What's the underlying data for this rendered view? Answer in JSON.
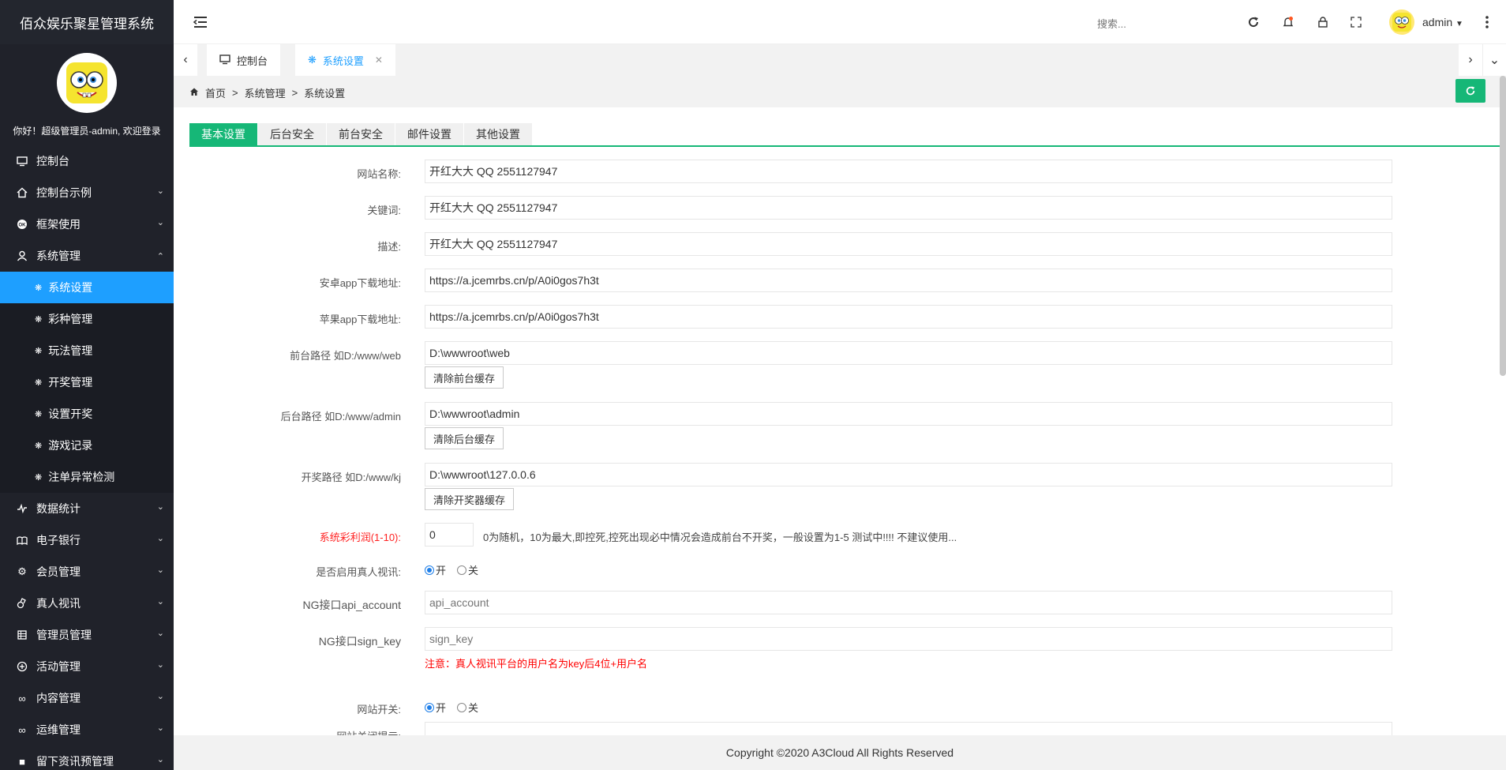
{
  "app": {
    "title": "佰众娱乐聚星管理系统",
    "welcome": "你好！超级管理员-admin, 欢迎登录"
  },
  "sidebar": {
    "items": [
      {
        "label": "控制台",
        "icon": "monitor-icon",
        "has_arrow": false
      },
      {
        "label": "控制台示例",
        "icon": "home-icon",
        "has_arrow": true
      },
      {
        "label": "框架使用",
        "icon": "ok-icon",
        "has_arrow": true
      },
      {
        "label": "系统管理",
        "icon": "user-icon",
        "has_arrow": true,
        "expanded": true
      }
    ],
    "sub_items": [
      {
        "label": "系统设置",
        "active": true
      },
      {
        "label": "彩种管理"
      },
      {
        "label": "玩法管理"
      },
      {
        "label": "开奖管理"
      },
      {
        "label": "设置开奖"
      },
      {
        "label": "游戏记录"
      },
      {
        "label": "注单异常检测"
      }
    ],
    "items_after": [
      {
        "label": "数据统计",
        "icon": "chart-icon"
      },
      {
        "label": "电子银行",
        "icon": "bank-icon"
      },
      {
        "label": "会员管理",
        "icon": "gear-icon"
      },
      {
        "label": "真人视讯",
        "icon": "video-icon"
      },
      {
        "label": "管理员管理",
        "icon": "grid-icon"
      },
      {
        "label": "活动管理",
        "icon": "plus-circle-icon"
      },
      {
        "label": "内容管理",
        "icon": "link-icon"
      },
      {
        "label": "运维管理",
        "icon": "link-icon"
      },
      {
        "label": "留下资讯预管理",
        "icon": "box-icon"
      }
    ]
  },
  "header": {
    "search_placeholder": "搜索...",
    "username": "admin"
  },
  "tabs": [
    {
      "label": "控制台",
      "icon": "monitor-icon",
      "active": false
    },
    {
      "label": "系统设置",
      "icon": "fan-icon",
      "active": true
    }
  ],
  "breadcrumb": {
    "home": "首页",
    "sep": ">",
    "level1": "系统管理",
    "level2": "系统设置"
  },
  "content_tabs": [
    "基本设置",
    "后台安全",
    "前台安全",
    "邮件设置",
    "其他设置"
  ],
  "form": {
    "site_name": {
      "label": "网站名称:",
      "value": "开红大大 QQ 2551127947"
    },
    "keywords": {
      "label": "关键词:",
      "value": "开红大大 QQ 2551127947"
    },
    "description": {
      "label": "描述:",
      "value": "开红大大 QQ 2551127947"
    },
    "android_url": {
      "label": "安卓app下载地址:",
      "value": "https://a.jcemrbs.cn/p/A0i0gos7h3t"
    },
    "ios_url": {
      "label": "苹果app下载地址:",
      "value": "https://a.jcemrbs.cn/p/A0i0gos7h3t"
    },
    "front_path": {
      "label": "前台路径 如D:/www/web",
      "value": "D:\\wwwroot\\web",
      "button": "清除前台缓存"
    },
    "admin_path": {
      "label": "后台路径 如D:/www/admin",
      "value": "D:\\wwwroot\\admin",
      "button": "清除后台缓存"
    },
    "lottery_path": {
      "label": "开奖路径 如D:/www/kj",
      "value": "D:\\wwwroot\\127.0.0.6",
      "button": "清除开奖器缓存"
    },
    "profit": {
      "label": "系统彩利润(1-10):",
      "value": "0",
      "hint": "0为随机，10为最大,即控死,控死出现必中情况会造成前台不开奖，一般设置为1-5 测试中!!!! 不建议使用..."
    },
    "live_video": {
      "label": "是否启用真人视讯:",
      "on": "开",
      "off": "关",
      "value": "on"
    },
    "ng_account": {
      "label": "NG接口api_account",
      "placeholder": "api_account"
    },
    "ng_sign": {
      "label": "NG接口sign_key",
      "placeholder": "sign_key"
    },
    "note": "注意：真人视讯平台的用户名为key后4位+用户名",
    "site_switch": {
      "label": "网站开关:",
      "on": "开",
      "off": "关",
      "value": "on"
    },
    "close_notice": {
      "label": "网站关闭提示:"
    }
  },
  "footer": {
    "copyright": "Copyright ©2020 A3Cloud All Rights Reserved"
  },
  "colors": {
    "sidebar_bg": "#20222a",
    "active_blue": "#1e9fff",
    "accent_green": "#16b777",
    "warning_red": "#ff0000"
  }
}
